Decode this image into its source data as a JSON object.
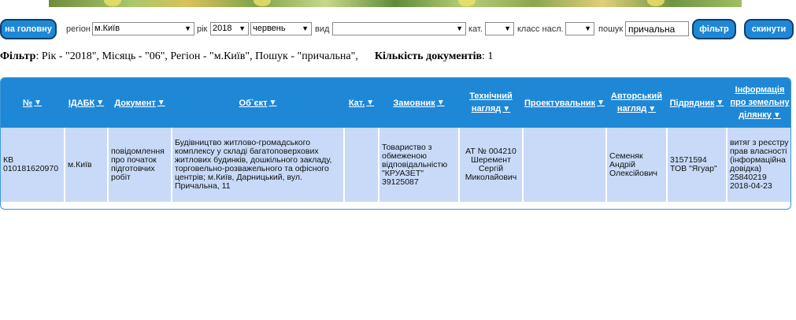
{
  "toolbar": {
    "home_label": "на головну",
    "region_label": "регіон",
    "region_value": "м.Київ",
    "year_label": "рік",
    "year_value": "2018",
    "month_value": "червень",
    "type_label": "вид",
    "type_value": "",
    "cat_label": "кат.",
    "cat_value": "",
    "class_label": "класс насл.",
    "class_value": "",
    "search_label": "пошук",
    "search_value": "причальна",
    "filter_label": "фільтр",
    "reset_label": "скинути"
  },
  "filter_summary": {
    "filter_label": "Фільтр",
    "filter_text": ": Рік - \"2018\", Місяць - \"06\", Регіон - \"м.Київ\", Пошук - \"причальна\",",
    "count_label": "Кількість документів",
    "count_value": ": 1"
  },
  "table": {
    "headers": [
      {
        "line1": "№"
      },
      {
        "line1": "ІДАБК"
      },
      {
        "line1": "Документ"
      },
      {
        "line1": "Об`єкт"
      },
      {
        "line1": "Кат."
      },
      {
        "line1": "Замовник"
      },
      {
        "line1": "Технічний",
        "line2": "нагляд"
      },
      {
        "line1": "Проектувальник"
      },
      {
        "line1": "Авторський",
        "line2": "нагляд"
      },
      {
        "line1": "Підрядник"
      },
      {
        "line1": "Інформація",
        "line2": "про земельну",
        "line3": "ділянку"
      }
    ],
    "sort_icon": "▼",
    "rows": [
      {
        "number": "КВ 010181620970",
        "idabk": "м.Київ",
        "document": "повідомлення про початок підготовчих робіт",
        "object": "Будівництво житлово-громадського комплексу у складі багатоповерхових житлових будинків, дошкільного закладу, торговельно-розважельного та офісного центрів; м.Київ, Дарницький, вул. Причальна, 11",
        "category": "",
        "customer": "Товариство з обмеженою відповідальністю \"КРУАЗЕТ\" 39125087",
        "tech_supervision": "АТ № 004210 Шеремент Сергій Миколайович",
        "designer": "",
        "author_supervision": "Семеняк Андрій Олексійович",
        "contractor": "31571594 ТОВ \"Ягуар\"",
        "land_info": "витяг з реєстру прав власності (інформаційна довідка) 25840219 2018-04-23"
      }
    ]
  },
  "colors": {
    "accent": "#1e88d6",
    "header_bg": "#1e88d6",
    "row_bg": "#c8daf8",
    "button_border": "#0c3f6c"
  }
}
